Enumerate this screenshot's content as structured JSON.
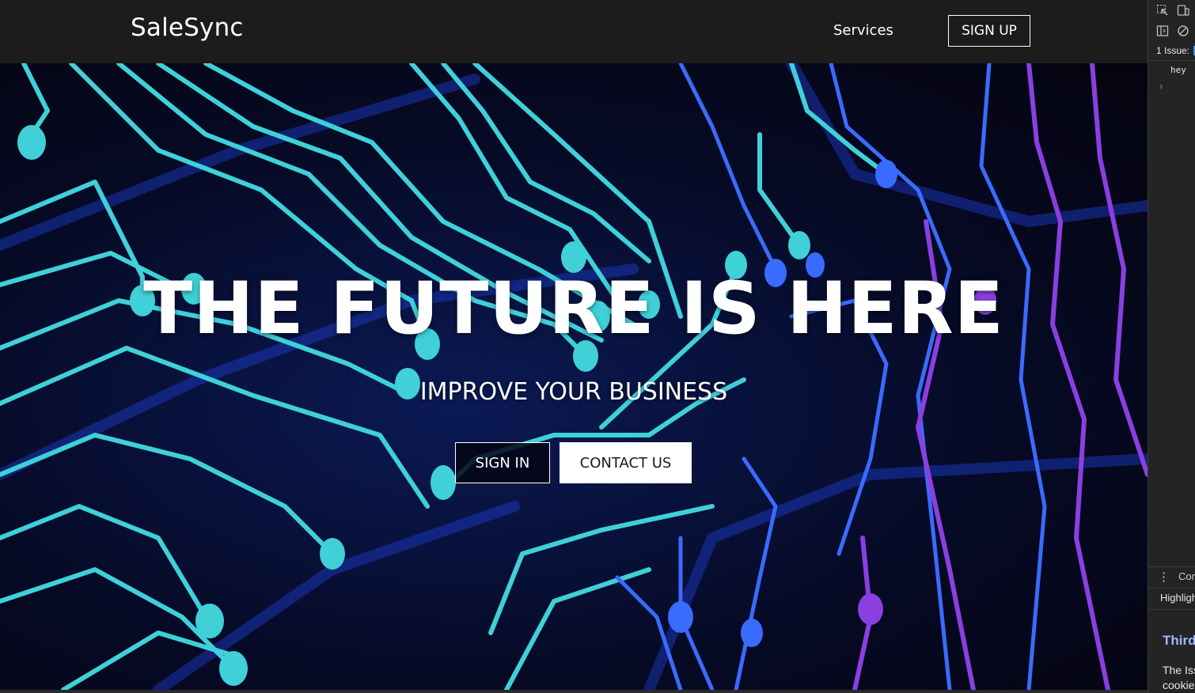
{
  "navbar": {
    "brand": "SaleSync",
    "services_label": "Services",
    "signup_label": "SIGN UP"
  },
  "hero": {
    "title": "THE FUTURE IS HERE",
    "subtitle": "IMPROVE YOUR BUSINESS",
    "signin_label": "SIGN IN",
    "contact_label": "CONTACT US",
    "background": "circuit-board-image"
  },
  "devtools": {
    "issues_label": "1 Issue:",
    "log_text": "hey",
    "console_tab_label": "Con",
    "highlight_label": "Highligh",
    "section_heading": "Third",
    "body_line1": "The Iss",
    "body_line2": "cookie"
  },
  "colors": {
    "navbar_bg": "#1c1c1c",
    "circuit_cyan": "#3fd0d8",
    "circuit_blue": "#2f6fff",
    "circuit_purple": "#8a3fe0",
    "devtools_bg": "#242424",
    "devtools_link": "#9fb8f5"
  }
}
